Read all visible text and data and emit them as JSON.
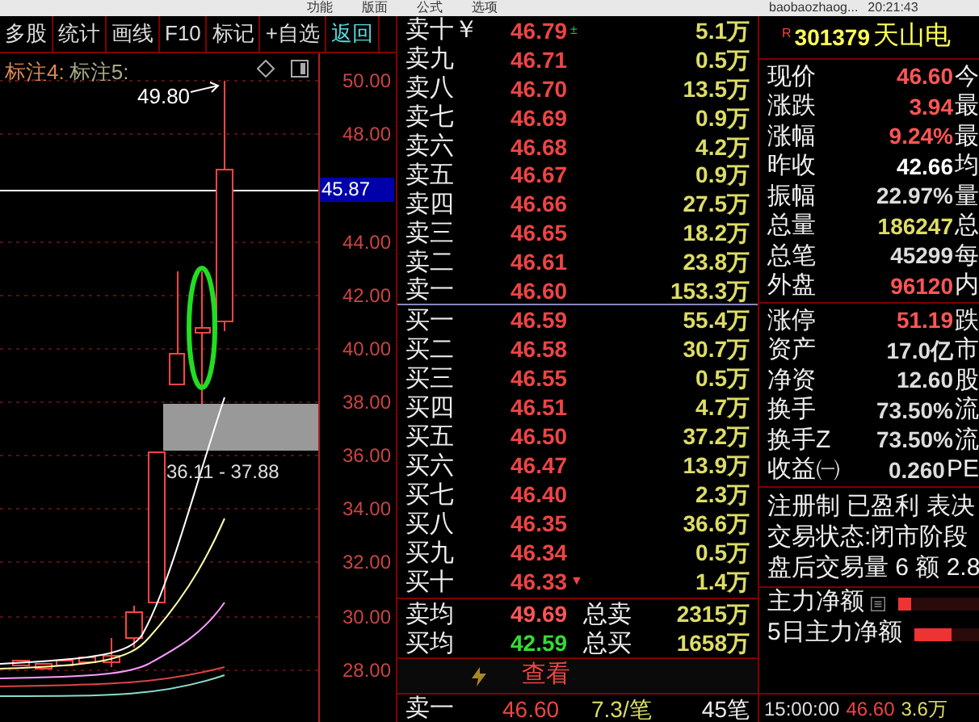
{
  "top_bar": {
    "menus": [
      "功能",
      "版面",
      "公式",
      "选项"
    ],
    "user": "baobaozhaog...",
    "time": "20:21:43"
  },
  "toolbar": [
    {
      "label": "多股",
      "selected": false
    },
    {
      "label": "统计",
      "selected": false
    },
    {
      "label": "画线",
      "selected": false
    },
    {
      "label": "F10",
      "selected": false
    },
    {
      "label": "标记",
      "selected": false
    },
    {
      "label": "+自选",
      "selected": false
    },
    {
      "label": "返回",
      "selected": true
    }
  ],
  "chart": {
    "legend": [
      "标注4:",
      "标注5:"
    ],
    "high_label": "49.80",
    "range_label": "36.11 - 37.88",
    "current_price": "45.87",
    "price_axis": [
      "50.00",
      "48.00",
      "44.00",
      "42.00",
      "40.00",
      "38.00",
      "36.00",
      "34.00",
      "32.00",
      "30.00",
      "28.00"
    ]
  },
  "order_book": {
    "asks": [
      {
        "label": "卖十￥",
        "price": "46.79",
        "volume": "5.1万",
        "marker": {
          "text": "±",
          "color": "#33aa55"
        }
      },
      {
        "label": "卖九",
        "price": "46.71",
        "volume": "0.5万"
      },
      {
        "label": "卖八",
        "price": "46.70",
        "volume": "13.5万"
      },
      {
        "label": "卖七",
        "price": "46.69",
        "volume": "0.9万"
      },
      {
        "label": "卖六",
        "price": "46.68",
        "volume": "4.2万"
      },
      {
        "label": "卖五",
        "price": "46.67",
        "volume": "0.9万"
      },
      {
        "label": "卖四",
        "price": "46.66",
        "volume": "27.5万"
      },
      {
        "label": "卖三",
        "price": "46.65",
        "volume": "18.2万"
      },
      {
        "label": "卖二",
        "price": "46.61",
        "volume": "23.8万"
      },
      {
        "label": "卖一",
        "price": "46.60",
        "volume": "153.3万"
      }
    ],
    "bids": [
      {
        "label": "买一",
        "price": "46.59",
        "volume": "55.4万"
      },
      {
        "label": "买二",
        "price": "46.58",
        "volume": "30.7万"
      },
      {
        "label": "买三",
        "price": "46.55",
        "volume": "0.5万"
      },
      {
        "label": "买四",
        "price": "46.51",
        "volume": "4.7万"
      },
      {
        "label": "买五",
        "price": "46.50",
        "volume": "37.2万"
      },
      {
        "label": "买六",
        "price": "46.47",
        "volume": "13.9万"
      },
      {
        "label": "买七",
        "price": "46.40",
        "volume": "2.3万"
      },
      {
        "label": "买八",
        "price": "46.35",
        "volume": "36.6万"
      },
      {
        "label": "买九",
        "price": "46.34",
        "volume": "0.5万"
      },
      {
        "label": "买十",
        "price": "46.33",
        "volume": "1.4万",
        "marker": {
          "text": "▼",
          "color": "#ee4444"
        }
      }
    ],
    "averages": [
      {
        "label": "卖均",
        "price": "49.69",
        "color": "#ff5555",
        "total_label": "总卖",
        "total": "2315万"
      },
      {
        "label": "买均",
        "price": "42.59",
        "color": "#33dd33",
        "total_label": "总买",
        "total": "1658万"
      }
    ],
    "link": "查看",
    "last_trade": {
      "label": "卖一",
      "price": "46.60",
      "volume": "7.3/笔",
      "count": "45笔"
    }
  },
  "quote": {
    "badge": "R",
    "code": "301379",
    "name": "天山电",
    "stats": [
      {
        "label": "现价",
        "value": "46.60",
        "color": "#ff5555",
        "next": "今"
      },
      {
        "label": "涨跌",
        "value": "3.94",
        "color": "#ff5555",
        "next": "最"
      },
      {
        "label": "涨幅",
        "value": "9.24%",
        "color": "#ff5555",
        "next": "最"
      },
      {
        "label": "昨收",
        "value": "42.66",
        "color": "#ffffff",
        "next": "均"
      },
      {
        "label": "振幅",
        "value": "22.97%",
        "color": "#dddddd",
        "next": "量"
      },
      {
        "label": "总量",
        "value": "186247",
        "color": "#dddd66",
        "next": "总"
      },
      {
        "label": "总笔",
        "value": "45299",
        "color": "#dddddd",
        "next": "每"
      },
      {
        "label": "外盘",
        "value": "96120",
        "color": "#ff5555",
        "next": "内"
      }
    ],
    "stats2": [
      {
        "label": "涨停",
        "value": "51.19",
        "color": "#ff5555",
        "next": "跌"
      },
      {
        "label": "资产",
        "value": "17.0亿",
        "color": "#dddddd",
        "next": "市"
      },
      {
        "label": "净资",
        "value": "12.60",
        "color": "#dddddd",
        "next": "股"
      },
      {
        "label": "换手",
        "value": "73.50%",
        "color": "#dddddd",
        "next": "流"
      },
      {
        "label": "换手Z",
        "value": "73.50%",
        "color": "#dddddd",
        "next": "流"
      },
      {
        "label": "收益㈠",
        "value": "0.260",
        "color": "#dddddd",
        "next": "PE"
      }
    ],
    "notes": [
      "注册制 已盈利 表决",
      "交易状态:闭市阶段",
      "盘后交易量 6 额 2.8"
    ],
    "flows": [
      {
        "label": "主力净额",
        "level": 0.15,
        "icon": true
      },
      {
        "label": "5日主力净额",
        "level": 0.45,
        "icon": false
      }
    ],
    "tick": {
      "time": "15:00:00",
      "price": "46.60",
      "volume": "3.6万"
    }
  }
}
